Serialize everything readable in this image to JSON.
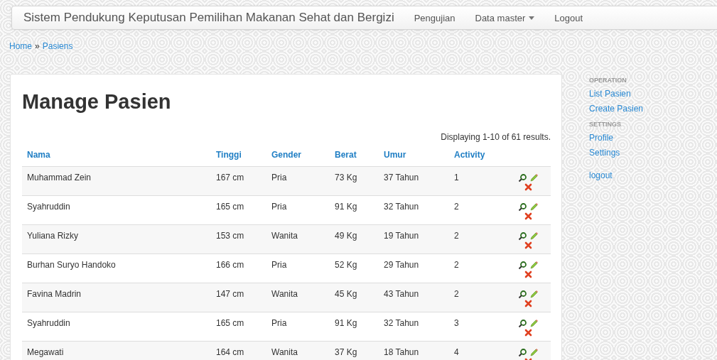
{
  "navbar": {
    "brand": "Sistem Pendukung Keputusan Pemilihan Makanan Sehat dan Bergizi",
    "items": [
      {
        "label": "Pengujian",
        "dropdown": false
      },
      {
        "label": "Data master",
        "dropdown": true
      },
      {
        "label": "Logout",
        "dropdown": false
      }
    ]
  },
  "breadcrumb": {
    "links": [
      "Home",
      "Pasiens"
    ],
    "separator": "»"
  },
  "page_title": "Manage Pasien",
  "summary": "Displaying 1-10 of 61 results.",
  "table": {
    "columns": [
      "Nama",
      "Tinggi",
      "Gender",
      "Berat",
      "Umur",
      "Activity"
    ],
    "rows": [
      {
        "cells": [
          "Muhammad Zein",
          "167 cm",
          "Pria",
          "73 Kg",
          "37 Tahun",
          "1"
        ]
      },
      {
        "cells": [
          "Syahruddin",
          "165 cm",
          "Pria",
          "91 Kg",
          "32 Tahun",
          "2"
        ]
      },
      {
        "cells": [
          "Yuliana Rizky",
          "153 cm",
          "Wanita",
          "49 Kg",
          "19 Tahun",
          "2"
        ]
      },
      {
        "cells": [
          "Burhan Suryo Handoko",
          "166 cm",
          "Pria",
          "52 Kg",
          "29 Tahun",
          "2"
        ]
      },
      {
        "cells": [
          "Favina Madrin",
          "147 cm",
          "Wanita",
          "45 Kg",
          "43 Tahun",
          "2"
        ]
      },
      {
        "cells": [
          "Syahruddin",
          "165 cm",
          "Pria",
          "91 Kg",
          "32 Tahun",
          "3"
        ]
      },
      {
        "cells": [
          "Megawati",
          "164 cm",
          "Wanita",
          "37 Kg",
          "18 Tahun",
          "4"
        ]
      }
    ]
  },
  "sidebar": {
    "sections": [
      {
        "heading": "OPERATION",
        "links": [
          "List Pasien",
          "Create Pasien"
        ]
      },
      {
        "heading": "SETTINGS",
        "links": [
          "Profile",
          "Settings"
        ]
      },
      {
        "links": [
          "logout"
        ]
      }
    ]
  }
}
